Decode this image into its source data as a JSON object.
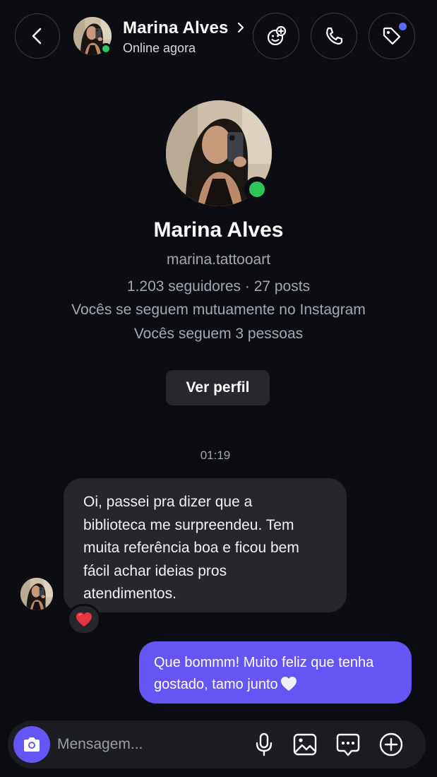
{
  "header": {
    "name": "Marina Alves",
    "status": "Online agora"
  },
  "profile": {
    "name": "Marina Alves",
    "username": "marina.tattooart",
    "stats": "1.203 seguidores · 27 posts",
    "mutual": "Vocês se seguem mutuamente no Instagram",
    "following": "Vocês seguem 3 pessoas",
    "view_profile_label": "Ver perfil"
  },
  "conversation": {
    "timestamp": "01:19",
    "incoming": {
      "lines": [
        "Oi, passei pra dizer que a",
        "biblioteca me surpreendeu. Tem",
        "muita referência boa e ficou bem",
        "fácil achar ideias pros",
        "atendimentos."
      ],
      "reaction": "heart-red-icon"
    },
    "outgoing": {
      "lines": [
        "Que bommm! Muito feliz que tenha",
        "gostado, tamo junto"
      ],
      "trailing_emoji": "heart-white-icon"
    }
  },
  "composer": {
    "placeholder": "Mensagem..."
  },
  "colors": {
    "background": "#0c0d12",
    "accent": "#6655f5",
    "online": "#2fc55d",
    "incoming_bubble": "#26272d",
    "notification_dot": "#5b6cf6"
  }
}
